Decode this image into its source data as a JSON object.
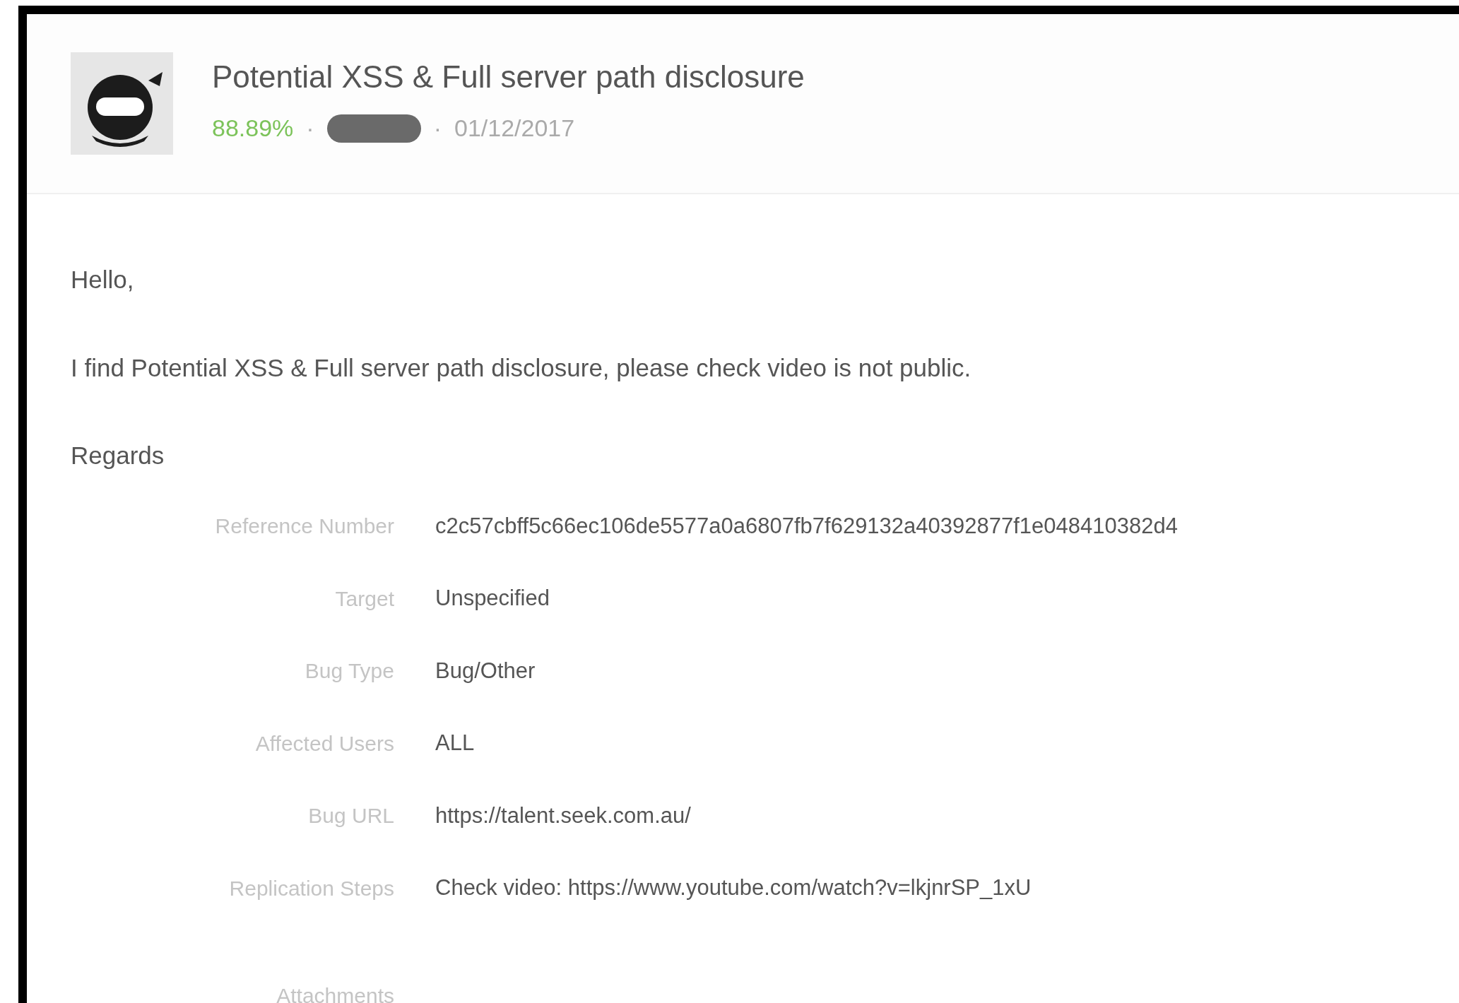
{
  "report": {
    "title": "Potential XSS & Full server path disclosure",
    "score": "88.89%",
    "separators": [
      "·",
      "·"
    ],
    "redacted": true,
    "date": "01/12/2017"
  },
  "body": {
    "paragraphs": [
      "Hello,",
      "I find Potential XSS & Full server path disclosure, please check video is not public.",
      "Regards"
    ]
  },
  "fields": [
    {
      "label": "Reference Number",
      "value": "c2c57cbff5c66ec106de5577a0a6807fb7f629132a40392877f1e048410382d4"
    },
    {
      "label": "Target",
      "value": "Unspecified"
    },
    {
      "label": "Bug Type",
      "value": "Bug/Other"
    },
    {
      "label": "Affected Users",
      "value": "ALL"
    },
    {
      "label": "Bug URL",
      "value": "https://talent.seek.com.au/"
    },
    {
      "label": "Replication Steps",
      "value": "Check video: https://www.youtube.com/watch?v=lkjnrSP_1xU"
    }
  ],
  "attachments": {
    "label": "Attachments"
  }
}
